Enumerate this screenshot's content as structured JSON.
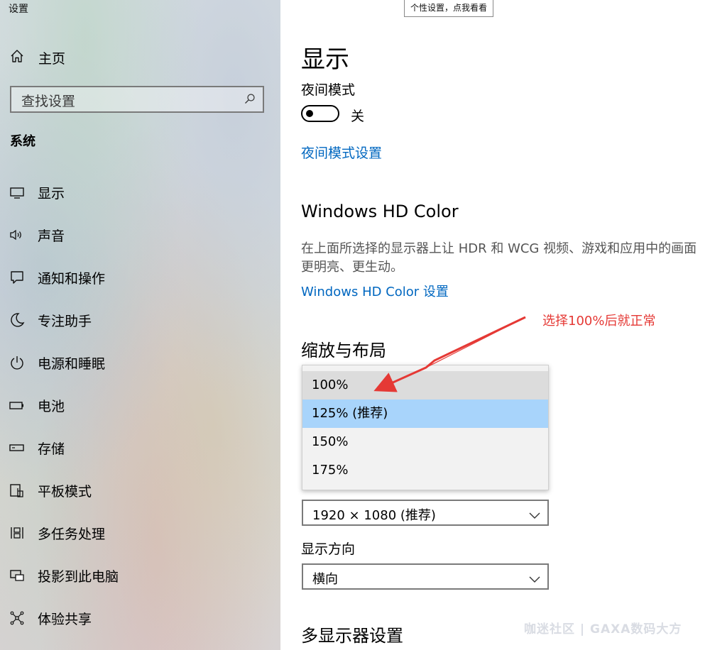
{
  "window": {
    "title": "设置"
  },
  "tooltip": "个性设置，点我看看",
  "sidebar": {
    "home_label": "主页",
    "search_placeholder": "查找设置",
    "section": "系统",
    "items": [
      {
        "label": "显示",
        "icon": "monitor-icon"
      },
      {
        "label": "声音",
        "icon": "speaker-icon"
      },
      {
        "label": "通知和操作",
        "icon": "notification-icon"
      },
      {
        "label": "专注助手",
        "icon": "moon-icon"
      },
      {
        "label": "电源和睡眠",
        "icon": "power-icon"
      },
      {
        "label": "电池",
        "icon": "battery-icon"
      },
      {
        "label": "存储",
        "icon": "storage-icon"
      },
      {
        "label": "平板模式",
        "icon": "tablet-icon"
      },
      {
        "label": "多任务处理",
        "icon": "multitask-icon"
      },
      {
        "label": "投影到此电脑",
        "icon": "project-icon"
      },
      {
        "label": "体验共享",
        "icon": "share-icon"
      }
    ]
  },
  "main": {
    "title": "显示",
    "night_mode": {
      "label": "夜间模式",
      "state": "关",
      "link": "夜间模式设置"
    },
    "hd_color": {
      "title": "Windows HD Color",
      "description": "在上面所选择的显示器上让 HDR 和 WCG 视频、游戏和应用中的画面更明亮、更生动。",
      "link": "Windows HD Color 设置"
    },
    "scale_layout": {
      "title": "缩放与布局",
      "options": [
        "100%",
        "125% (推荐)",
        "150%",
        "175%"
      ],
      "selected": "125% (推荐)",
      "hovered": "100%"
    },
    "resolution": {
      "value": "1920 × 1080 (推荐)"
    },
    "orientation": {
      "label": "显示方向",
      "value": "横向"
    },
    "multi_display_title": "多显示器设置"
  },
  "annotation": {
    "text": "选择100%后就正常",
    "color": "#e53935"
  },
  "watermark": "咖迷社区 | GAXA数码大方",
  "colors": {
    "accent": "#0067c0",
    "selected_option": "#a8d4fb"
  }
}
